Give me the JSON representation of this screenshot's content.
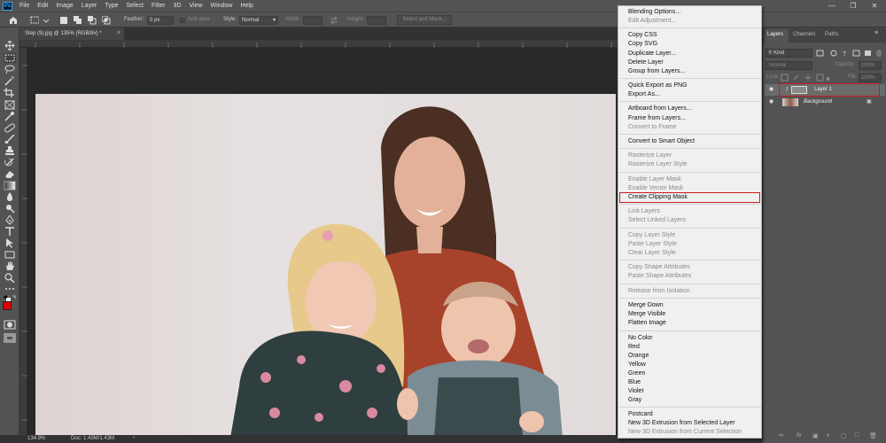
{
  "app": {
    "logo": "Ps",
    "menu": [
      "File",
      "Edit",
      "Image",
      "Layer",
      "Type",
      "Select",
      "Filter",
      "3D",
      "View",
      "Window",
      "Help"
    ],
    "window_controls": [
      "minimize-icon",
      "restore-icon",
      "close-icon"
    ]
  },
  "options_bar": {
    "feather_label": "Feather:",
    "feather_value": "0 px",
    "anti_alias_label": "Anti-alias",
    "style_label": "Style:",
    "style_value": "Normal",
    "width_label": "Width:",
    "height_label": "Height:",
    "select_mask_label": "Select and Mask..."
  },
  "document": {
    "tab_title": "Step (9).jpg @ 135% (RGB/8#) *",
    "image_description_icon": "family-photo"
  },
  "status_bar": {
    "zoom": "134.9%",
    "doc_size": "Doc: 1.43M/1.43M"
  },
  "layers_panel": {
    "tabs": [
      "Layers",
      "Channels",
      "Paths"
    ],
    "kind_label": "Kind",
    "blend_mode": "Normal",
    "opacity_label": "Opacity:",
    "opacity_value": "100%",
    "lock_label": "Lock:",
    "fill_label": "Fill:",
    "fill_value": "100%",
    "layers": [
      {
        "name": "Layer 1",
        "visible": true,
        "selected": true
      },
      {
        "name": "Background",
        "visible": true,
        "locked": true
      }
    ]
  },
  "context_menu": {
    "items": [
      {
        "label": "Blending Options...",
        "disabled": false
      },
      {
        "label": "Edit Adjustment...",
        "disabled": true
      },
      {
        "sep": true
      },
      {
        "label": "Copy CSS",
        "disabled": false
      },
      {
        "label": "Copy SVG",
        "disabled": false
      },
      {
        "label": "Duplicate Layer...",
        "disabled": false
      },
      {
        "label": "Delete Layer",
        "disabled": false
      },
      {
        "label": "Group from Layers...",
        "disabled": false
      },
      {
        "sep": true
      },
      {
        "label": "Quick Export as PNG",
        "disabled": false
      },
      {
        "label": "Export As...",
        "disabled": false
      },
      {
        "sep": true
      },
      {
        "label": "Artboard from Layers...",
        "disabled": false
      },
      {
        "label": "Frame from Layers...",
        "disabled": false
      },
      {
        "label": "Convert to Frame",
        "disabled": true
      },
      {
        "sep": true
      },
      {
        "label": "Convert to Smart Object",
        "disabled": false
      },
      {
        "sep": true
      },
      {
        "label": "Rasterize Layer",
        "disabled": true
      },
      {
        "label": "Rasterize Layer Style",
        "disabled": true
      },
      {
        "sep": true
      },
      {
        "label": "Enable Layer Mask",
        "disabled": true
      },
      {
        "label": "Enable Vector Mask",
        "disabled": true
      },
      {
        "label": "Create Clipping Mask",
        "disabled": false,
        "highlighted": true
      },
      {
        "sep": true
      },
      {
        "label": "Link Layers",
        "disabled": true
      },
      {
        "label": "Select Linked Layers",
        "disabled": true
      },
      {
        "sep": true
      },
      {
        "label": "Copy Layer Style",
        "disabled": true
      },
      {
        "label": "Paste Layer Style",
        "disabled": true
      },
      {
        "label": "Clear Layer Style",
        "disabled": true
      },
      {
        "sep": true
      },
      {
        "label": "Copy Shape Attributes",
        "disabled": true
      },
      {
        "label": "Paste Shape Attributes",
        "disabled": true
      },
      {
        "sep": true
      },
      {
        "label": "Release from Isolation",
        "disabled": true
      },
      {
        "sep": true
      },
      {
        "label": "Merge Down",
        "disabled": false
      },
      {
        "label": "Merge Visible",
        "disabled": false
      },
      {
        "label": "Flatten Image",
        "disabled": false
      },
      {
        "sep": true
      },
      {
        "label": "No Color",
        "disabled": false
      },
      {
        "label": "Red",
        "disabled": false
      },
      {
        "label": "Orange",
        "disabled": false
      },
      {
        "label": "Yellow",
        "disabled": false
      },
      {
        "label": "Green",
        "disabled": false
      },
      {
        "label": "Blue",
        "disabled": false
      },
      {
        "label": "Violet",
        "disabled": false
      },
      {
        "label": "Gray",
        "disabled": false
      },
      {
        "sep": true
      },
      {
        "label": "Postcard",
        "disabled": false
      },
      {
        "label": "New 3D Extrusion from Selected Layer",
        "disabled": false
      },
      {
        "label": "New 3D Extrusion from Current Selection",
        "disabled": true
      }
    ]
  },
  "colors": {
    "foreground": "#e00000",
    "background": "#ffffff",
    "highlight_border": "#c51d1d",
    "ps_blue": "#31a8ff"
  }
}
